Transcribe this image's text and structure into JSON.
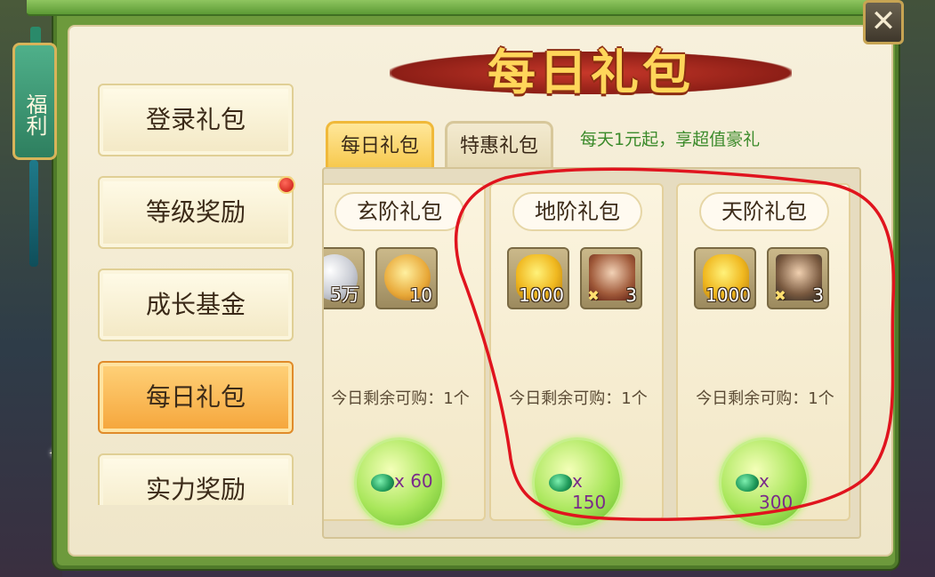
{
  "title": "每日礼包",
  "side_tag": "福利",
  "close_icon": "close-icon",
  "nav": {
    "items": [
      {
        "label": "登录礼包",
        "active": false
      },
      {
        "label": "等级奖励",
        "active": false,
        "badge": true
      },
      {
        "label": "成长基金",
        "active": false
      },
      {
        "label": "每日礼包",
        "active": true
      },
      {
        "label": "实力奖励",
        "active": false
      }
    ]
  },
  "tabs": [
    {
      "label": "每日礼包",
      "active": true
    },
    {
      "label": "特惠礼包",
      "active": false
    }
  ],
  "tagline": "每天1元起，享超值豪礼",
  "gifts": [
    {
      "title": "玄阶礼包",
      "items": [
        {
          "icon": "silver-coin-icon",
          "qty": "5万"
        },
        {
          "icon": "gourd-icon",
          "qty": "10"
        }
      ],
      "remain": "今日剩余可购：1个",
      "price": "x 60"
    },
    {
      "title": "地阶礼包",
      "items": [
        {
          "icon": "gold-ingot-icon",
          "qty": "1000"
        },
        {
          "icon": "hero-fragment-icon",
          "qty": "3"
        }
      ],
      "remain": "今日剩余可购：1个",
      "price": "x 150"
    },
    {
      "title": "天阶礼包",
      "items": [
        {
          "icon": "gold-ingot-icon",
          "qty": "1000"
        },
        {
          "icon": "hero-fragment-icon",
          "qty": "3"
        }
      ],
      "remain": "今日剩余可购：1个",
      "price": "x 300"
    }
  ],
  "colors": {
    "frame_green": "#6d9a3c",
    "title_gold": "#ffd65a",
    "tagline_green": "#3a8a2a",
    "price_purple": "#7a2a8a",
    "annotation_red": "#e0141e"
  }
}
